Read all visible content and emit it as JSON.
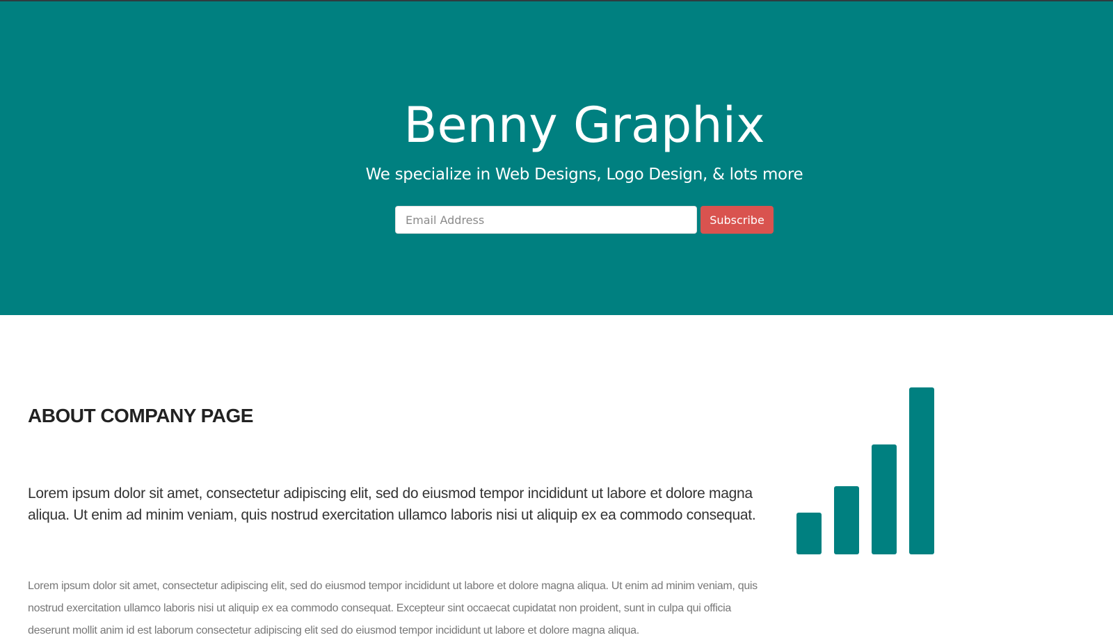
{
  "hero": {
    "title": "Benny Graphix",
    "subtitle": "We specialize in Web Designs, Logo Design, & lots more",
    "email_placeholder": "Email Address",
    "subscribe_label": "Subscribe"
  },
  "about": {
    "heading": "ABOUT COMPANY PAGE",
    "lead": "Lorem ipsum dolor sit amet, consectetur adipiscing elit, sed do eiusmod tempor incididunt ut labore et dolore magna aliqua. Ut enim ad minim veniam, quis nostrud exercitation ullamco laboris nisi ut aliquip ex ea commodo consequat.",
    "body": "Lorem ipsum dolor sit amet, consectetur adipiscing elit, sed do eiusmod tempor incididunt ut labore et dolore magna aliqua. Ut enim ad minim veniam, quis nostrud exercitation ullamco laboris nisi ut aliquip ex ea commodo consequat. Excepteur sint occaecat cupidatat non proident, sunt in culpa qui officia deserunt mollit anim id est laborum consectetur adipiscing elit sed do eiusmod tempor incididunt ut labore et dolore magna aliqua."
  },
  "signal_icon": {
    "name": "signal-bars-icon",
    "levels": [
      0.25,
      0.41,
      0.66,
      1.0
    ]
  },
  "colors": {
    "brand": "#008080",
    "accent": "#d9534f",
    "heading": "#222222",
    "text": "#333333",
    "muted": "#777777"
  }
}
